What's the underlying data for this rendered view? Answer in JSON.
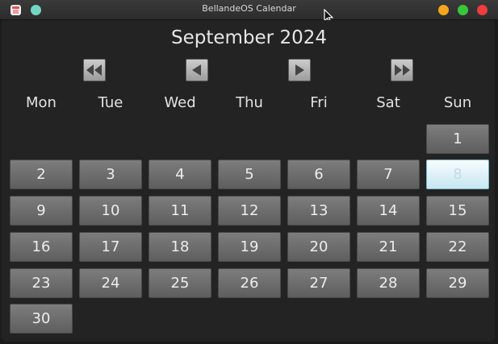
{
  "window": {
    "title": "BellandeOS Calendar"
  },
  "calendar": {
    "month_title": "September 2024",
    "weekdays": [
      "Mon",
      "Tue",
      "Wed",
      "Thu",
      "Fri",
      "Sat",
      "Sun"
    ],
    "days": [
      {
        "d": "1",
        "col": 6,
        "row": 0
      },
      {
        "d": "2",
        "col": 0,
        "row": 1
      },
      {
        "d": "3",
        "col": 1,
        "row": 1
      },
      {
        "d": "4",
        "col": 2,
        "row": 1
      },
      {
        "d": "5",
        "col": 3,
        "row": 1
      },
      {
        "d": "6",
        "col": 4,
        "row": 1
      },
      {
        "d": "7",
        "col": 5,
        "row": 1
      },
      {
        "d": "8",
        "col": 6,
        "row": 1,
        "selected": true
      },
      {
        "d": "9",
        "col": 0,
        "row": 2
      },
      {
        "d": "10",
        "col": 1,
        "row": 2
      },
      {
        "d": "11",
        "col": 2,
        "row": 2
      },
      {
        "d": "12",
        "col": 3,
        "row": 2
      },
      {
        "d": "13",
        "col": 4,
        "row": 2
      },
      {
        "d": "14",
        "col": 5,
        "row": 2
      },
      {
        "d": "15",
        "col": 6,
        "row": 2
      },
      {
        "d": "16",
        "col": 0,
        "row": 3
      },
      {
        "d": "17",
        "col": 1,
        "row": 3
      },
      {
        "d": "18",
        "col": 2,
        "row": 3
      },
      {
        "d": "19",
        "col": 3,
        "row": 3
      },
      {
        "d": "20",
        "col": 4,
        "row": 3
      },
      {
        "d": "21",
        "col": 5,
        "row": 3
      },
      {
        "d": "22",
        "col": 6,
        "row": 3
      },
      {
        "d": "23",
        "col": 0,
        "row": 4
      },
      {
        "d": "24",
        "col": 1,
        "row": 4
      },
      {
        "d": "25",
        "col": 2,
        "row": 4
      },
      {
        "d": "26",
        "col": 3,
        "row": 4
      },
      {
        "d": "27",
        "col": 4,
        "row": 4
      },
      {
        "d": "28",
        "col": 5,
        "row": 4
      },
      {
        "d": "29",
        "col": 6,
        "row": 4
      },
      {
        "d": "30",
        "col": 0,
        "row": 5
      }
    ],
    "selected_day": "8"
  },
  "colors": {
    "background": "#232323",
    "day_button": "#6d6d6d",
    "selected_day": "#d9eef6",
    "close": "#ee3d3d",
    "minimize": "#f4a61c",
    "maximize": "#38c73a"
  }
}
